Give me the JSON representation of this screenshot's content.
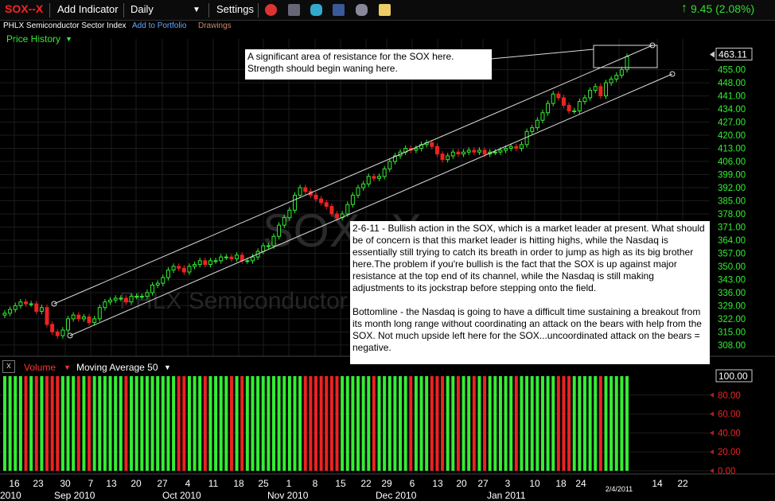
{
  "toolbar": {
    "symbol": "SOX--X",
    "add_indicator": "Add Indicator",
    "interval": "Daily",
    "settings": "Settings",
    "change": "9.45 (2.08%)",
    "change_color": "#33dd33",
    "icons": [
      "alarm-clock-icon",
      "layers-icon",
      "twitter-icon",
      "facebook-icon",
      "binoculars-icon",
      "note-icon"
    ]
  },
  "subbar": {
    "name": "PHLX Semiconductor Sector Index",
    "add_portfolio": "Add to Portfolio",
    "drawings": "Drawings"
  },
  "price_history": {
    "label": "Price History"
  },
  "watermark": {
    "symbol": "SOX--X",
    "name": "PHLX Semiconductor Sector Index"
  },
  "notes": {
    "resistance": "A significant area of resistance for the SOX here. Strength should begin waning here.",
    "analysis_p1": "2-6-11 - Bullish action in the SOX, which is a market leader at present. What should be of concern is that this market leader is hitting highs, while the Nasdaq is essentially still trying to catch its breath in order to jump as high as its big brother here.The problem if you're bullish is the fact that the SOX is up against major resistance at the top end of its channel, while the Nasdaq is still making adjustments to its jockstrap before stepping onto the field.",
    "analysis_p2": "Bottomline - the Nasdaq is going to have a difficult time sustaining a breakout from its month long range without coordinating an attack on the bears with help from the SOX. Not much upside left here for the SOX...uncoordinated attack on the bears = negative."
  },
  "volume_panel": {
    "close_label": "x",
    "volume_label": "Volume",
    "ma_label": "Moving Average 50"
  },
  "chart_data": [
    {
      "type": "candlestick",
      "ylim": [
        302,
        468
      ],
      "y_ticks": [
        "455.00",
        "448.00",
        "441.00",
        "434.00",
        "427.00",
        "420.00",
        "413.00",
        "406.00",
        "399.00",
        "392.00",
        "385.00",
        "378.00",
        "371.00",
        "364.00",
        "357.00",
        "350.00",
        "343.00",
        "336.00",
        "329.00",
        "322.00",
        "315.00",
        "308.00"
      ],
      "last_price": "463.11",
      "up_color": "#33ee33",
      "down_color": "#ee2222",
      "axis_label_color": "#ee2222",
      "x_tick_labels": [
        "16",
        "23",
        "30",
        "7",
        "13",
        "20",
        "27",
        "4",
        "11",
        "18",
        "25",
        "1",
        "8",
        "15",
        "22",
        "29",
        "6",
        "13",
        "20",
        "27",
        "3",
        "10",
        "18",
        "24",
        "2/4/2011",
        "14",
        "22"
      ],
      "x_month_labels": [
        "2010",
        "Sep 2010",
        "Oct 2010",
        "Nov 2010",
        "Dec 2010",
        "Jan 2011"
      ],
      "grid": true,
      "closes": [
        325,
        327,
        329,
        331,
        330,
        330,
        326,
        328,
        319,
        315,
        313,
        316,
        322,
        324,
        322,
        323,
        320,
        322,
        328,
        331,
        332,
        333,
        333,
        331,
        334,
        334,
        334,
        336,
        340,
        341,
        344,
        348,
        350,
        349,
        347,
        350,
        351,
        353,
        351,
        353,
        353,
        355,
        355,
        354,
        356,
        353,
        353,
        355,
        358,
        361,
        361,
        366,
        372,
        376,
        380,
        388,
        392,
        390,
        388,
        386,
        384,
        382,
        378,
        376,
        378,
        383,
        388,
        392,
        394,
        398,
        397,
        398,
        402,
        406,
        409,
        411,
        413,
        412,
        413,
        415,
        416,
        414,
        410,
        407,
        409,
        411,
        410,
        411,
        412,
        411,
        412,
        410,
        411,
        411,
        412,
        413,
        414,
        413,
        415,
        422,
        424,
        428,
        432,
        437,
        442,
        440,
        436,
        433,
        433,
        438,
        440,
        444,
        446,
        441,
        448,
        450,
        452,
        455,
        462
      ]
    },
    {
      "type": "bar",
      "name": "Volume",
      "moving_average": "Moving Average 50",
      "ylim": [
        0,
        100
      ],
      "y_ticks": [
        "100.00",
        "80.00",
        "60.00",
        "40.00",
        "20.00",
        "0.00"
      ],
      "values": [
        100,
        100,
        100,
        100,
        100,
        100,
        100,
        100,
        100,
        100,
        100,
        100,
        100,
        100,
        100,
        100,
        100,
        100,
        100,
        100,
        100,
        100,
        100,
        100,
        100,
        100,
        100,
        100,
        100,
        100,
        100,
        100,
        100,
        100,
        100,
        100,
        100,
        100,
        100,
        100,
        100,
        100,
        100,
        100,
        100,
        100,
        100,
        100,
        100,
        100,
        100,
        100,
        100,
        100,
        100,
        100,
        100,
        100,
        100,
        100,
        100,
        100,
        100,
        100,
        100,
        100,
        100,
        100,
        100,
        100,
        100,
        100,
        100,
        100,
        100,
        100,
        100,
        100,
        100,
        100,
        100,
        100,
        100,
        100,
        100,
        100,
        100,
        100,
        100,
        100,
        100,
        100,
        100,
        100,
        100,
        100,
        100,
        100,
        100,
        100,
        100,
        100,
        100,
        100,
        100,
        100,
        100,
        100,
        100,
        100,
        100,
        100,
        100,
        100,
        100,
        100,
        100,
        100,
        100
      ]
    }
  ]
}
